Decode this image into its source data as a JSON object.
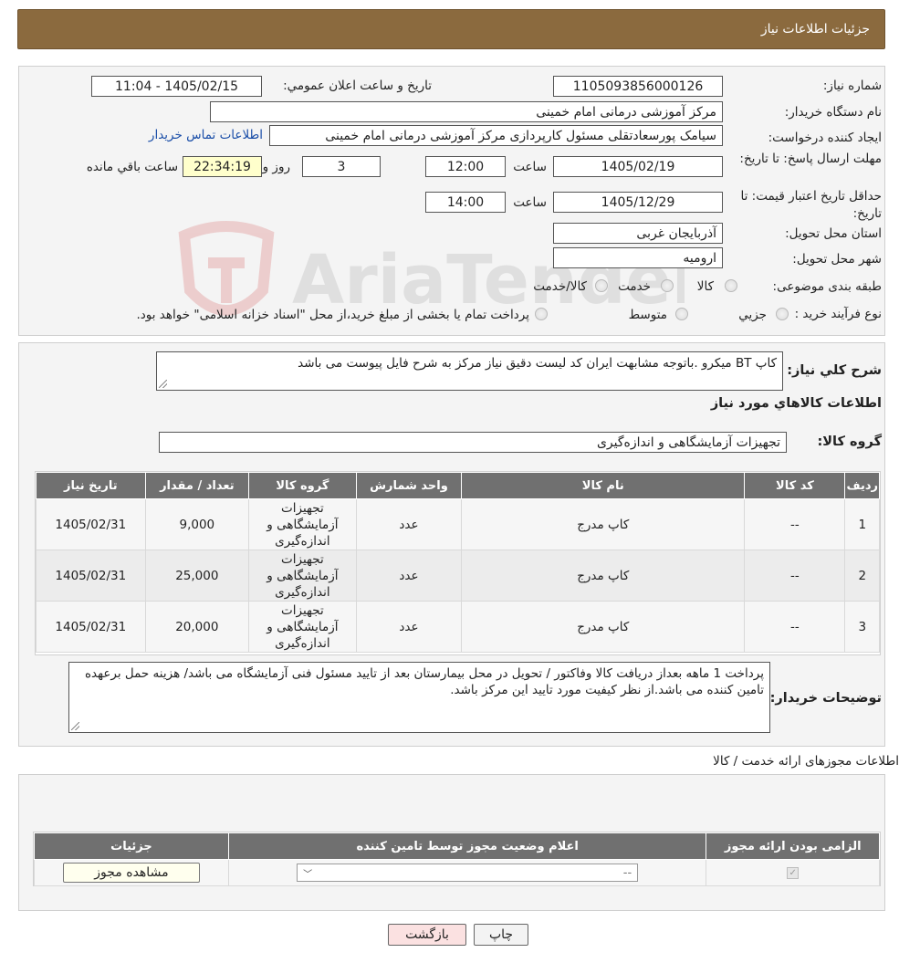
{
  "header": {
    "title": "جزئیات اطلاعات نیاز"
  },
  "form": {
    "need_number_label": "شماره نیاز:",
    "need_number": "1105093856000126",
    "announce_label": "تاریخ و ساعت اعلان عمومي:",
    "announce_value": "1405/02/15 - 11:04",
    "buyer_label": "نام دستگاه خريدار:",
    "buyer_value": "مرکز آموزشی درمانی امام خمینی",
    "creator_label": "ايجاد کننده درخواست:",
    "creator_value": "سیامک پورسعادتقلی مسئول کارپردازی مرکز آموزشی درمانی امام خمینی",
    "contact_link": "اطلاعات تماس خريدار",
    "deadline_label": "مهلت ارسال پاسخ: تا تاريخ:",
    "deadline_date": "1405/02/19",
    "time_label": "ساعت",
    "deadline_time": "12:00",
    "days_value": "3",
    "days_label": "روز و",
    "remaining_time": "22:34:19",
    "remaining_label": "ساعت باقي مانده",
    "validity_label": "حداقل تاريخ اعتبار قيمت: تا تاريخ:",
    "validity_date": "1405/12/29",
    "validity_time": "14:00",
    "province_label": "استان محل تحويل:",
    "province_value": "آذربايجان غربی",
    "city_label": "شهر محل تحويل:",
    "city_value": "اروميه",
    "category_label": "طبقه بندی موضوعی:",
    "category_options": [
      "کالا",
      "خدمت",
      "کالا/خدمت"
    ],
    "process_label": "نوع فرآيند خريد :",
    "process_options": [
      "جزيي",
      "متوسط"
    ],
    "process_note": "پرداخت تمام يا بخشی از مبلغ خريد،از محل \"اسناد خزانه اسلامی\" خواهد بود."
  },
  "description": {
    "label": "شرح کلي نياز:",
    "text": "کاپ BT میکرو .باتوجه مشابهت ایران کد لیست دقیق نیاز مرکز به شرح فایل پیوست می باشد"
  },
  "goods": {
    "section_title": "اطلاعات کالاهاي مورد نياز",
    "group_label": "گروه کالا:",
    "group_value": "تجهیزات آزمایشگاهی و اندازه‌گیری",
    "columns": [
      "رديف",
      "کد کالا",
      "نام کالا",
      "واحد شمارش",
      "گروه کالا",
      "تعداد / مقدار",
      "تاريخ نياز"
    ],
    "rows": [
      {
        "index": "1",
        "code": "--",
        "name": "کاپ مدرج",
        "unit": "عدد",
        "group": "تجهیزات آزمایشگاهی و اندازه‌گیری",
        "qty": "9,000",
        "date": "1405/02/31"
      },
      {
        "index": "2",
        "code": "--",
        "name": "کاپ مدرج",
        "unit": "عدد",
        "group": "تجهیزات آزمایشگاهی و اندازه‌گیری",
        "qty": "25,000",
        "date": "1405/02/31"
      },
      {
        "index": "3",
        "code": "--",
        "name": "کاپ مدرج",
        "unit": "عدد",
        "group": "تجهیزات آزمایشگاهی و اندازه‌گیری",
        "qty": "20,000",
        "date": "1405/02/31"
      }
    ]
  },
  "buyer_notes": {
    "label": "توضيحات خريدار:",
    "text": "پرداخت 1 ماهه بعداز دریافت کالا وفاکتور / تحویل در محل بیمارستان بعد از تایید مسئول فنی آزمایشگاه  می باشد/  هزینه حمل برعهده تامین کننده می باشد.از نظر کیفیت مورد تایید این مرکز باشد."
  },
  "licenses": {
    "title": "اطلاعات مجوزهای ارائه خدمت / کالا",
    "columns": [
      "الزامی بودن ارائه مجوز",
      "اعلام وضعيت مجوز توسط تامين کننده",
      "جزئيات"
    ],
    "select_value": "--",
    "view_button": "مشاهده مجوز"
  },
  "footer": {
    "print_button": "چاپ",
    "back_button": "بازگشت"
  },
  "watermark": {
    "text": "AriaTender.neT"
  },
  "colors": {
    "header_bg": "#8b6a3e",
    "table_header_bg": "#707070",
    "link": "#1a4ea8",
    "back_button_bg": "#fbe1e1"
  }
}
